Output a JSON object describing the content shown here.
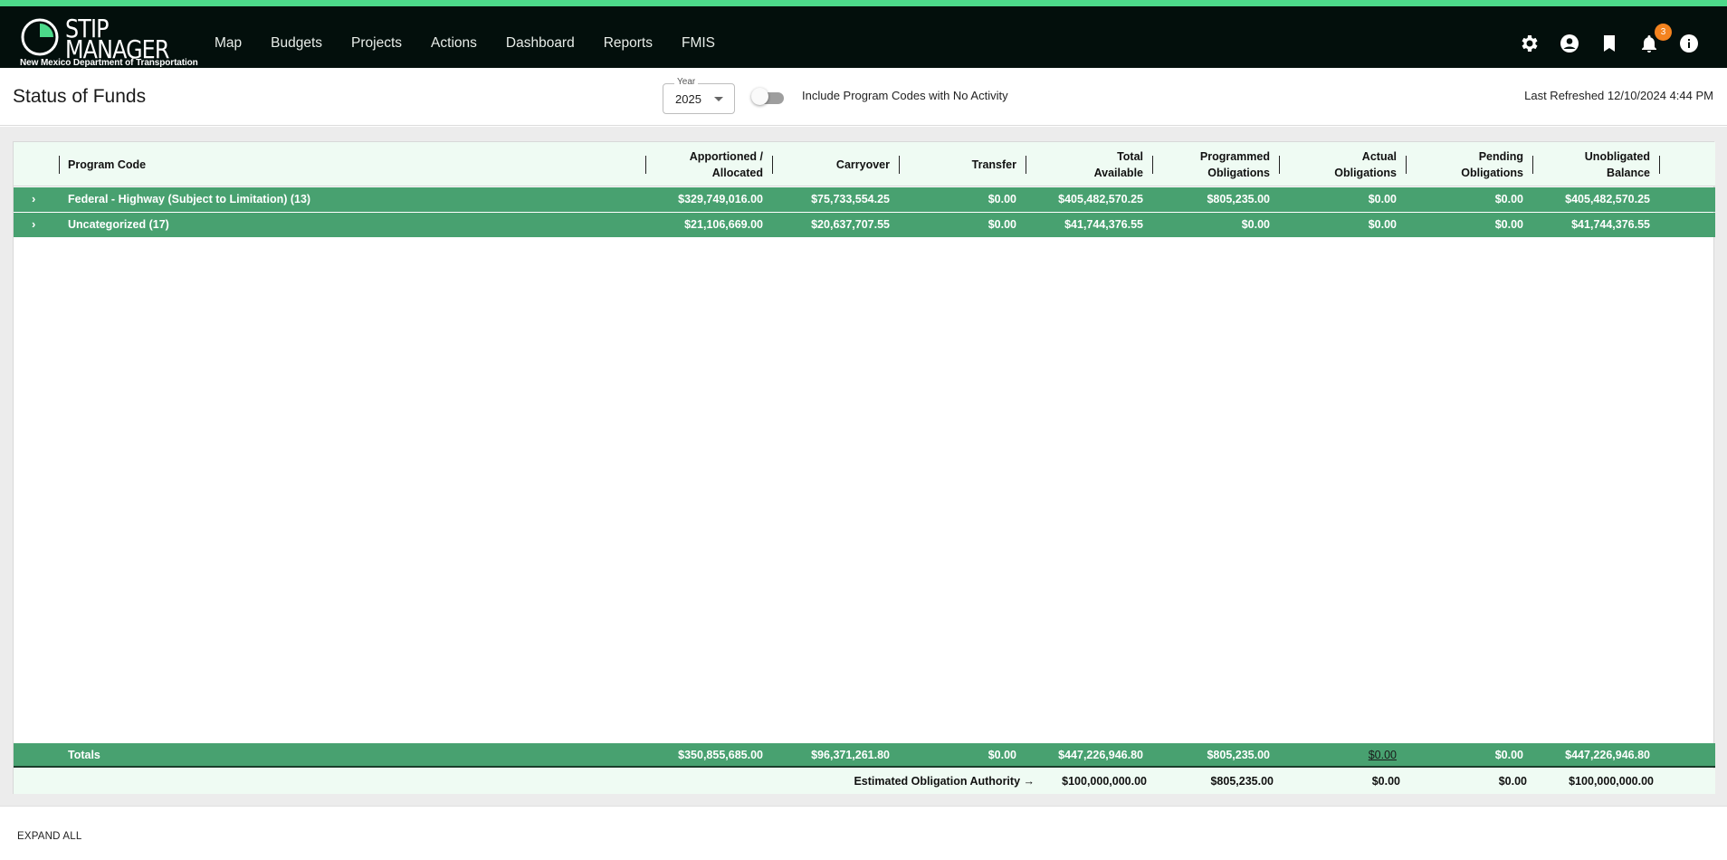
{
  "app": {
    "logo_line1": "STIP",
    "logo_line2": "MANAGER",
    "logo_sub": "New Mexico Department of Transportation",
    "accent": "#4cd98a",
    "row_color": "#48a170",
    "nav_bg": "#030f0c"
  },
  "nav": {
    "items": [
      "Map",
      "Budgets",
      "Projects",
      "Actions",
      "Dashboard",
      "Reports",
      "FMIS"
    ],
    "icons": [
      "gear-icon",
      "account-circle-icon",
      "bookmark-icon",
      "bell-icon",
      "info-icon"
    ],
    "notification_count": "3"
  },
  "page": {
    "title": "Status of Funds",
    "year_label": "Year",
    "year_value": "2025",
    "toggle_label": "Include Program Codes with No Activity",
    "toggle_on": false,
    "last_refreshed": "Last Refreshed 12/10/2024 4:44 PM"
  },
  "table": {
    "columns": [
      {
        "line1": "Program Code",
        "line2": ""
      },
      {
        "line1": "Apportioned /",
        "line2": "Allocated"
      },
      {
        "line1": "Carryover",
        "line2": ""
      },
      {
        "line1": "Transfer",
        "line2": ""
      },
      {
        "line1": "Total",
        "line2": "Available"
      },
      {
        "line1": "Programmed",
        "line2": "Obligations"
      },
      {
        "line1": "Actual",
        "line2": "Obligations"
      },
      {
        "line1": "Pending",
        "line2": "Obligations"
      },
      {
        "line1": "Unobligated",
        "line2": "Balance"
      }
    ],
    "rows": [
      {
        "name": "Federal - Highway (Subject to Limitation) (13)",
        "values": [
          "$329,749,016.00",
          "$75,733,554.25",
          "$0.00",
          "$405,482,570.25",
          "$805,235.00",
          "$0.00",
          "$0.00",
          "$405,482,570.25"
        ]
      },
      {
        "name": "Uncategorized (17)",
        "values": [
          "$21,106,669.00",
          "$20,637,707.55",
          "$0.00",
          "$41,744,376.55",
          "$0.00",
          "$0.00",
          "$0.00",
          "$41,744,376.55"
        ]
      }
    ],
    "totals": {
      "label": "Totals",
      "values": [
        "$350,855,685.00",
        "$96,371,261.80",
        "$0.00",
        "$447,226,946.80",
        "$805,235.00",
        "$0.00",
        "$0.00",
        "$447,226,946.80"
      ]
    },
    "eoa": {
      "label": "Estimated Obligation Authority →",
      "values": [
        "$100,000,000.00",
        "$805,235.00",
        "$0.00",
        "$0.00",
        "$100,000,000.00"
      ]
    }
  },
  "footer": {
    "expand_all": "EXPAND ALL"
  }
}
